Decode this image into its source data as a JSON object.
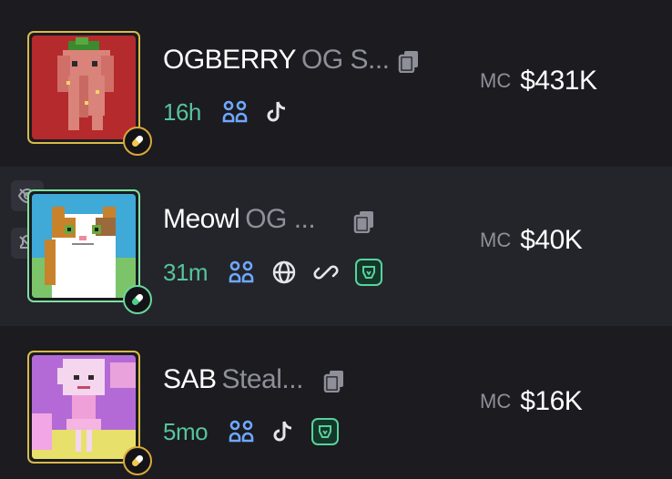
{
  "tokens": [
    {
      "symbol": "OGBERRY",
      "name": "OG S...",
      "age": "16h",
      "mc_label": "MC",
      "mc_value": "$431K",
      "social_icons": [
        "holders-icon",
        "tiktok-icon"
      ]
    },
    {
      "symbol": "Meowl",
      "name": "OG ...",
      "age": "31m",
      "mc_label": "MC",
      "mc_value": "$40K",
      "social_icons": [
        "holders-icon",
        "globe-icon",
        "link-icon",
        "fang-icon"
      ]
    },
    {
      "symbol": "SAB",
      "name": "Steal...",
      "age": "5mo",
      "mc_label": "MC",
      "mc_value": "$16K",
      "social_icons": [
        "holders-icon",
        "tiktok-icon",
        "fang-icon"
      ]
    }
  ],
  "colors": {
    "background": "#1b1b20",
    "hovered_row": "#24252b",
    "age_green": "#56c49a",
    "holders_blue": "#6fa8ff",
    "gold_border": "#d9b94a",
    "green_border": "#7ee0a0"
  }
}
